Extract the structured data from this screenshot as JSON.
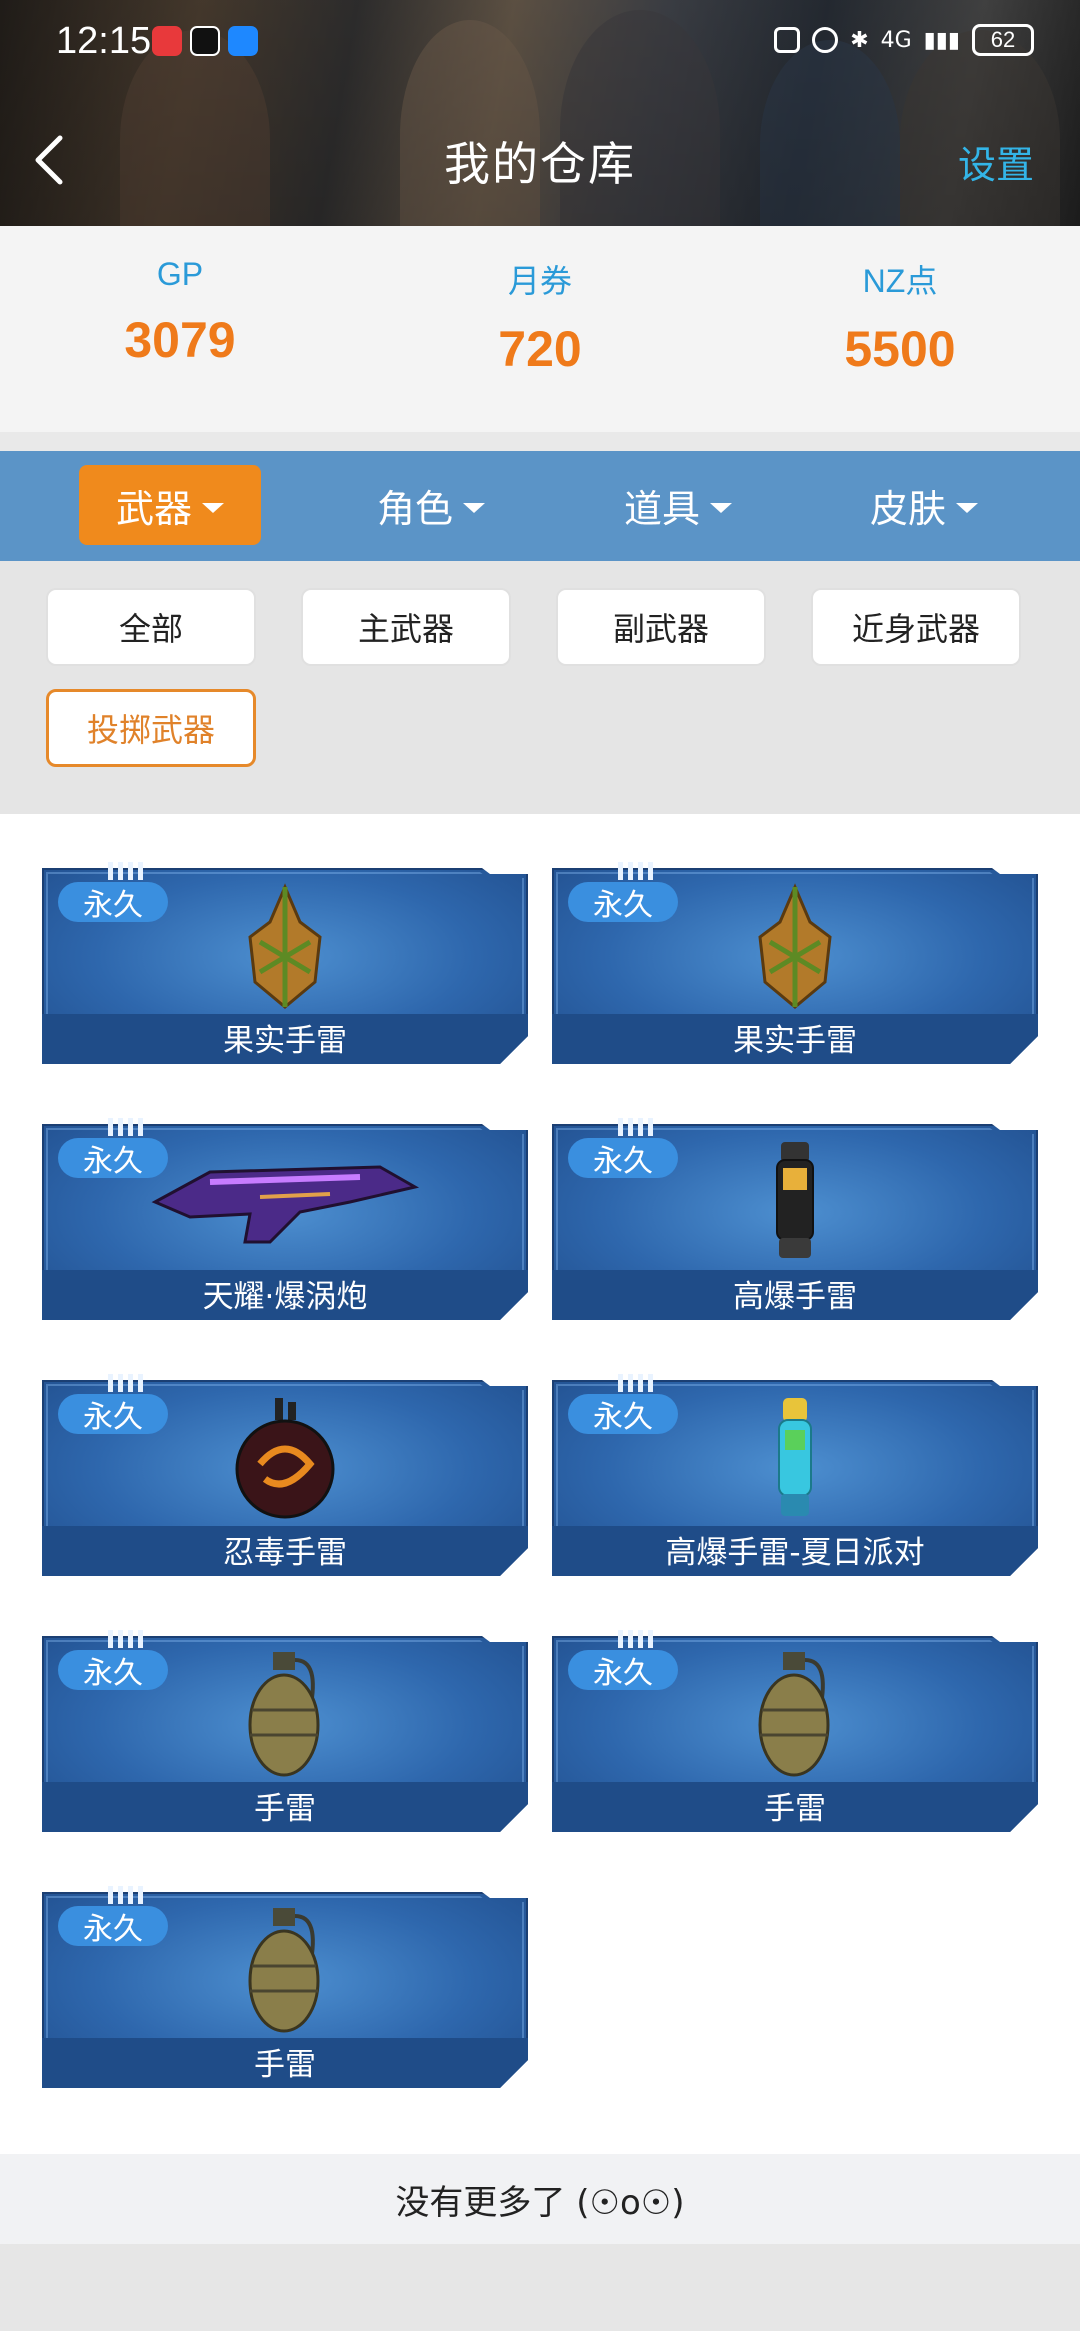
{
  "status_bar": {
    "time": "12:15",
    "network": "4G",
    "battery": "62"
  },
  "header": {
    "title": "我的仓库",
    "settings_label": "设置"
  },
  "stats": [
    {
      "label": "GP",
      "value": "3079"
    },
    {
      "label": "月券",
      "value": "720"
    },
    {
      "label": "NZ点",
      "value": "5500"
    }
  ],
  "tabs": [
    {
      "label": "武器",
      "active": true
    },
    {
      "label": "角色",
      "active": false
    },
    {
      "label": "道具",
      "active": false
    },
    {
      "label": "皮肤",
      "active": false
    }
  ],
  "filters": [
    {
      "label": "全部",
      "active": false
    },
    {
      "label": "主武器",
      "active": false
    },
    {
      "label": "副武器",
      "active": false
    },
    {
      "label": "近身武器",
      "active": false
    },
    {
      "label": "投掷武器",
      "active": true
    }
  ],
  "items": [
    {
      "name": "果实手雷",
      "badge": "永久",
      "icon": "fruit-grenade-icon"
    },
    {
      "name": "果实手雷",
      "badge": "永久",
      "icon": "fruit-grenade-icon"
    },
    {
      "name": "天耀·爆涡炮",
      "badge": "永久",
      "icon": "vortex-cannon-icon"
    },
    {
      "name": "高爆手雷",
      "badge": "永久",
      "icon": "he-grenade-icon"
    },
    {
      "name": "忍毒手雷",
      "badge": "永久",
      "icon": "poison-grenade-icon"
    },
    {
      "name": "高爆手雷-夏日派对",
      "badge": "永久",
      "icon": "summer-grenade-icon"
    },
    {
      "name": "手雷",
      "badge": "永久",
      "icon": "frag-grenade-icon"
    },
    {
      "name": "手雷",
      "badge": "永久",
      "icon": "frag-grenade-icon"
    },
    {
      "name": "手雷",
      "badge": "永久",
      "icon": "frag-grenade-icon"
    }
  ],
  "footer": {
    "no_more": "没有更多了 (☉o☉)"
  },
  "colors": {
    "accent_orange": "#f08a1c",
    "tab_bar_blue": "#5b94c7",
    "stat_label_blue": "#2a9ad8",
    "stat_value_orange": "#ef7a1a"
  }
}
